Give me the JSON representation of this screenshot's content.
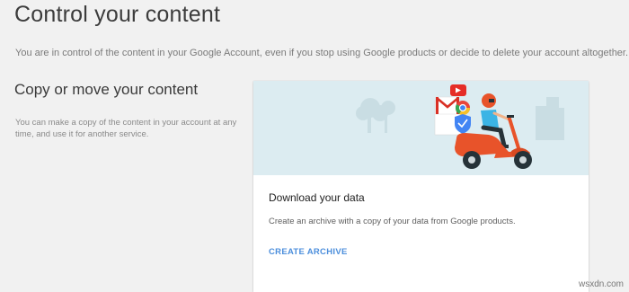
{
  "page": {
    "title": "Control your content",
    "intro": "You are in control of the content in your Google Account, even if you stop using Google products or decide to delete your account altogether."
  },
  "section": {
    "title": "Copy or move your content",
    "description": "You can make a copy of the content in your account at any time, and use it for another service."
  },
  "card": {
    "illustration_icon": "scooter-delivery-illustration",
    "title": "Download your data",
    "description": "Create an archive with a copy of your data from Google products.",
    "action_label": "CREATE ARCHIVE"
  },
  "watermark": "wsxdn.com",
  "colors": {
    "background": "#f1f1f1",
    "card": "#ffffff",
    "illustration_bg": "#dcecf1",
    "link_blue": "#4b8edc",
    "scooter_red": "#e8532a"
  }
}
